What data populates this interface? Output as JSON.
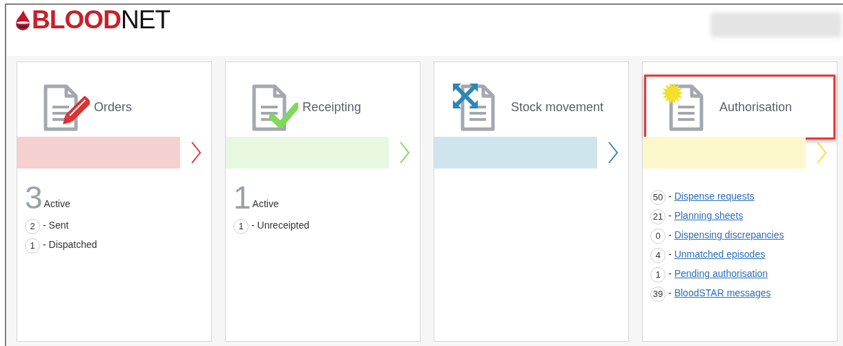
{
  "logo": {
    "bold": "BLOOD",
    "light": "NET"
  },
  "cards": [
    {
      "kind": "orders",
      "title": "Orders",
      "color": "#e03030",
      "highlighted": false,
      "active_count": "3",
      "active_label": "Active",
      "items": [
        {
          "count": "2",
          "label": "- Sent",
          "link": false
        },
        {
          "count": "1",
          "label": "- Dispatched",
          "link": false
        }
      ]
    },
    {
      "kind": "receipting",
      "title": "Receipting",
      "color": "#7ed957",
      "highlighted": false,
      "active_count": "1",
      "active_label": "Active",
      "items": [
        {
          "count": "1",
          "label": "- Unreceipted",
          "link": false
        }
      ]
    },
    {
      "kind": "stock",
      "title": "Stock movement",
      "color": "#2e86b8",
      "highlighted": false
    },
    {
      "kind": "authorisation",
      "title": "Authorisation",
      "color": "#f2e02a",
      "highlighted": true,
      "items": [
        {
          "count": "50",
          "prefix": "-",
          "label": "Dispense requests",
          "link": true
        },
        {
          "count": "21",
          "prefix": "-",
          "label": "Planning sheets",
          "link": true
        },
        {
          "count": "0",
          "prefix": "-",
          "label": "Dispensing discrepancies",
          "link": true
        },
        {
          "count": "4",
          "prefix": "-",
          "label": "Unmatched episodes",
          "link": true
        },
        {
          "count": "1",
          "prefix": "-",
          "label": "Pending authorisation",
          "link": true
        },
        {
          "count": "39",
          "prefix": "-",
          "label": "BloodSTAR messages",
          "link": true
        }
      ]
    }
  ]
}
